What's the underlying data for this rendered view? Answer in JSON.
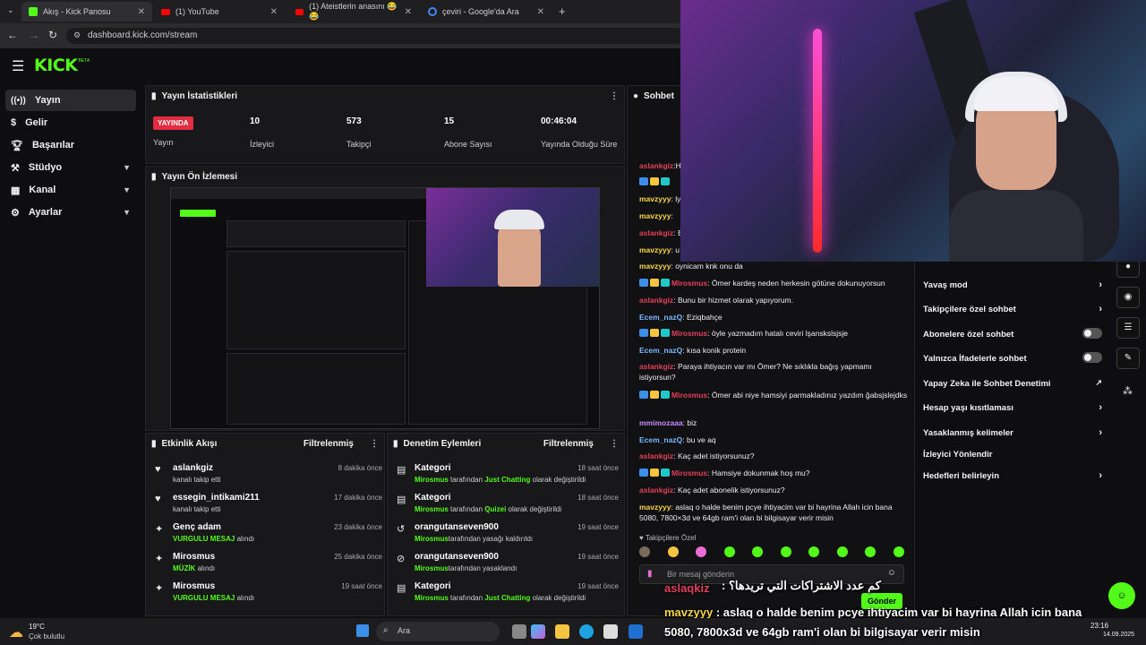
{
  "browser": {
    "tabs": [
      {
        "title": "Akış - Kick Panosu",
        "icon_color": "#53fc18"
      },
      {
        "title": "(1) YouTube",
        "icon_color": "#ff0000"
      },
      {
        "title": "(1) Ateistlerin anasını 😂😂",
        "icon_color": "#ff0000"
      },
      {
        "title": "çeviri - Google'da Ara",
        "icon_color": "#4285f4"
      }
    ],
    "url": "dashboard.kick.com/stream"
  },
  "logo": {
    "text": "KICK",
    "suffix": "BETA"
  },
  "sidebar": {
    "items": [
      {
        "label": "Yayın",
        "icon": "broadcast-icon"
      },
      {
        "label": "Gelir",
        "icon": "dollar-icon"
      },
      {
        "label": "Başarılar",
        "icon": "trophy-icon"
      },
      {
        "label": "Stüdyo",
        "icon": "studio-icon"
      },
      {
        "label": "Kanal",
        "icon": "channel-icon"
      },
      {
        "label": "Ayarlar",
        "icon": "gear-icon"
      }
    ]
  },
  "stats": {
    "title": "Yayın İstatistikleri",
    "live_badge": "YAYINDA",
    "live_label": "Yayın",
    "items": [
      {
        "value": "10",
        "label": "İzleyici"
      },
      {
        "value": "573",
        "label": "Takipçi"
      },
      {
        "value": "15",
        "label": "Abone Sayısı"
      },
      {
        "value": "00:46:04",
        "label": "Yayında Olduğu Süre"
      }
    ]
  },
  "preview": {
    "title": "Yayın Ön İzlemesi"
  },
  "activity": {
    "title": "Etkinlik Akışı",
    "filter": "Filtrelenmiş",
    "items": [
      {
        "name": "aslankgiz",
        "sub": "kanalı takip etti",
        "time": "8 dakika önce",
        "highlight": ""
      },
      {
        "name": "essegin_intikami211",
        "sub": "kanalı takip etti",
        "time": "17 dakika önce",
        "highlight": ""
      },
      {
        "name": "Genç adam",
        "sub": "alındı",
        "time": "23 dakika önce",
        "highlight": "VURGULU MESAJ"
      },
      {
        "name": "Mirosmus",
        "sub": "alındı",
        "time": "25 dakika önce",
        "highlight": "MÜZİK"
      },
      {
        "name": "Mirosmus",
        "sub": "alındı",
        "time": "19 saat önce",
        "highlight": "VURGULU MESAJ"
      }
    ]
  },
  "moderation": {
    "title": "Denetim Eylemleri",
    "filter": "Filtrelenmiş",
    "items": [
      {
        "name": "Kategori",
        "actor": "Mirosmus",
        "mid": " tarafından ",
        "target": "Just Chatting",
        "tail": " olarak değiştirildi",
        "time": "18 saat önce"
      },
      {
        "name": "Kategori",
        "actor": "Mirosmus",
        "mid": " tarafından ",
        "target": "Quizei",
        "tail": " olarak değiştirildi",
        "time": "18 saat önce"
      },
      {
        "name": "orangutanseven900",
        "actor": "Mirosmus",
        "mid": "tarafından yasağı kaldırıldı",
        "target": "",
        "tail": "",
        "time": "19 saat önce"
      },
      {
        "name": "orangutanseven900",
        "actor": "Mirosmus",
        "mid": "tarafından yasaklandı",
        "target": "",
        "tail": "",
        "time": "19 saat önce"
      },
      {
        "name": "Kategori",
        "actor": "Mirosmus",
        "mid": " tarafından ",
        "target": "Just Chatting",
        "tail": " olarak değiştirildi",
        "time": "19 saat önce"
      }
    ]
  },
  "chat": {
    "title": "Sohbet",
    "messages": [
      {
        "user": "aslankgiz",
        "cls": "u-red",
        "badges": false,
        "text": "H"
      },
      {
        "user": "",
        "cls": "u-red",
        "badges": true,
        "text": ""
      },
      {
        "user": "mavzyyy",
        "cls": "u-yel",
        "badges": false,
        "text": " ly"
      },
      {
        "user": "mavzyyy",
        "cls": "u-yel",
        "badges": false,
        "text": ""
      },
      {
        "user": "aslankgiz",
        "cls": "u-red",
        "badges": false,
        "text": " B"
      },
      {
        "user": "mavzyyy",
        "cls": "u-yel",
        "badges": false,
        "text": " u"
      },
      {
        "user": "mavzyyy",
        "cls": "u-yel",
        "badges": false,
        "text": " oynicam knk onu da"
      },
      {
        "user": "Mirosmus",
        "cls": "u-red",
        "badges": true,
        "text": " Ömer kardeş neden herkesin götüne dokunuyorsun"
      },
      {
        "user": "aslankgiz",
        "cls": "u-red",
        "badges": false,
        "text": " Bunu bir hizmet olarak yapıyorum."
      },
      {
        "user": "Ecem_nazQ",
        "cls": "u-blu",
        "badges": false,
        "text": " Eziqbahçe"
      },
      {
        "user": "Mirosmus",
        "cls": "u-red",
        "badges": true,
        "text": " öyle yazmadım hatalı ceviri lşanskslsjsje"
      },
      {
        "user": "Ecem_nazQ",
        "cls": "u-blu",
        "badges": false,
        "text": " kısa konik protein"
      },
      {
        "user": "aslankgiz",
        "cls": "u-red",
        "badges": false,
        "text": " Paraya ihtiyacın var mı Ömer? Ne sıklıkla bağış yapmamı istiyorsun?"
      },
      {
        "user": "Mirosmus",
        "cls": "u-red",
        "badges": true,
        "text": " Ömer abi niye hamsiyi parmakladınız yazdım ğabsjslejdks"
      },
      {
        "user": "mmimozaaa",
        "cls": "u-pur",
        "badges": false,
        "text": " biz"
      },
      {
        "user": "Ecem_nazQ",
        "cls": "u-blu",
        "badges": false,
        "text": " bu ve aq"
      },
      {
        "user": "aslankgiz",
        "cls": "u-red",
        "badges": false,
        "text": " Kaç adet istiyorsunuz?"
      },
      {
        "user": "Mirosmus",
        "cls": "u-red",
        "badges": true,
        "text": " Hamsiye dokunmak hoş mu?"
      },
      {
        "user": "aslankgiz",
        "cls": "u-red",
        "badges": false,
        "text": " Kaç adet abonelik istiyorsunuz?"
      },
      {
        "user": "mavzyyy",
        "cls": "u-yel",
        "badges": false,
        "text": " aslaq o halde benim pcye ihtiyacim var bi hayrina Allah icin bana 5080, 7800×3d ve 64gb ram'i olan bi bilgisayar verir misin"
      }
    ],
    "followers_only_label": "Takipçilere Özel",
    "input_placeholder": "Bir mesaj gönderin",
    "send_label": "Gönder"
  },
  "chat_settings": {
    "items": [
      {
        "label": "Yavaş mod",
        "control": "arrow"
      },
      {
        "label": "Takipçilere özel sohbet",
        "control": "arrow"
      },
      {
        "label": "Abonelere özel sohbet",
        "control": "toggle"
      },
      {
        "label": "Yalnızca İfadelerle sohbet",
        "control": "toggle"
      },
      {
        "label": "Yapay Zeka ile Sohbet Denetimi",
        "control": "external"
      },
      {
        "label": "Hesap yaşı kısıtlaması",
        "control": "arrow"
      },
      {
        "label": "Yasaklanmış kelimeler",
        "control": "arrow"
      },
      {
        "label": "İzleyici Yönlendir",
        "control": "none"
      },
      {
        "label": "Hedefleri belirleyin",
        "control": "arrow"
      }
    ]
  },
  "overlay": {
    "user1": "aslaqkiz",
    "arabic": "كم عدد الاشتراكات التي تريدها؟",
    "user2": "mavzyyy",
    "line1": "aslaq o halde benim pcye ihtiyacim var bi hayrina Allah icin bana",
    "line2": "5080, 7800x3d ve 64gb ram'i olan bi bilgisayar verir misin"
  },
  "taskbar": {
    "weather_temp": "19°C",
    "weather_desc": "Çok bulutlu",
    "search_placeholder": "Ara",
    "time": "23:16",
    "date": "14.09.2025"
  }
}
